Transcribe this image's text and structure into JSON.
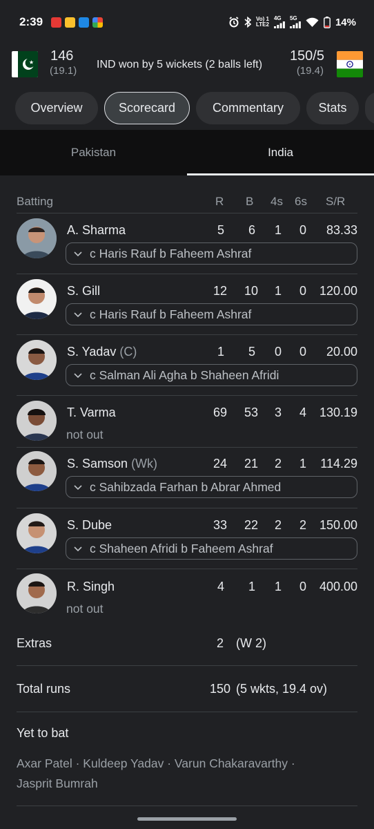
{
  "status_bar": {
    "time": "2:39",
    "net_top": "Vo) 1",
    "net_bottom": "LTE2",
    "net_4g": "4G",
    "net_5g": "5G",
    "battery": "14%"
  },
  "match": {
    "team1": {
      "score": "146",
      "overs": "(19.1)"
    },
    "team2": {
      "score": "150/5",
      "overs": "(19.4)"
    },
    "result": "IND won by 5 wickets (2 balls left)"
  },
  "tabs": [
    "Overview",
    "Scorecard",
    "Commentary",
    "Stats"
  ],
  "team_tabs": {
    "left": "Pakistan",
    "right": "India"
  },
  "table_header": {
    "batting": "Batting",
    "r": "R",
    "b": "B",
    "fours": "4s",
    "sixes": "6s",
    "sr": "S/R"
  },
  "batters": [
    {
      "name": "A. Sharma",
      "role": "",
      "r": "5",
      "b": "6",
      "fours": "1",
      "sixes": "0",
      "sr": "83.33",
      "dismissal": "c Haris Rauf b Faheem Ashraf"
    },
    {
      "name": "S. Gill",
      "role": "",
      "r": "12",
      "b": "10",
      "fours": "1",
      "sixes": "0",
      "sr": "120.00",
      "dismissal": "c Haris Rauf b Faheem Ashraf"
    },
    {
      "name": "S. Yadav",
      "role": "(C)",
      "r": "1",
      "b": "5",
      "fours": "0",
      "sixes": "0",
      "sr": "20.00",
      "dismissal": "c Salman Ali Agha b Shaheen Afridi"
    },
    {
      "name": "T. Varma",
      "role": "",
      "r": "69",
      "b": "53",
      "fours": "3",
      "sixes": "4",
      "sr": "130.19",
      "dismissal": "not out"
    },
    {
      "name": "S. Samson",
      "role": "(Wk)",
      "r": "24",
      "b": "21",
      "fours": "2",
      "sixes": "1",
      "sr": "114.29",
      "dismissal": "c Sahibzada Farhan b Abrar Ahmed"
    },
    {
      "name": "S. Dube",
      "role": "",
      "r": "33",
      "b": "22",
      "fours": "2",
      "sixes": "2",
      "sr": "150.00",
      "dismissal": "c Shaheen Afridi b Faheem Ashraf"
    },
    {
      "name": "R. Singh",
      "role": "",
      "r": "4",
      "b": "1",
      "fours": "1",
      "sixes": "0",
      "sr": "400.00",
      "dismissal": "not out"
    }
  ],
  "extras": {
    "label": "Extras",
    "value": "2",
    "detail": "(W 2)"
  },
  "total": {
    "label": "Total runs",
    "value": "150",
    "detail": "(5 wkts, 19.4 ov)"
  },
  "yet_to_bat": {
    "label": "Yet to bat",
    "players": "Axar Patel · Kuldeep Yadav · Varun Chakaravarthy · Jasprit Bumrah"
  },
  "colors": {
    "background": "#202124",
    "chip": "#303134",
    "text": "#e8eaed",
    "muted": "#9aa0a6"
  }
}
